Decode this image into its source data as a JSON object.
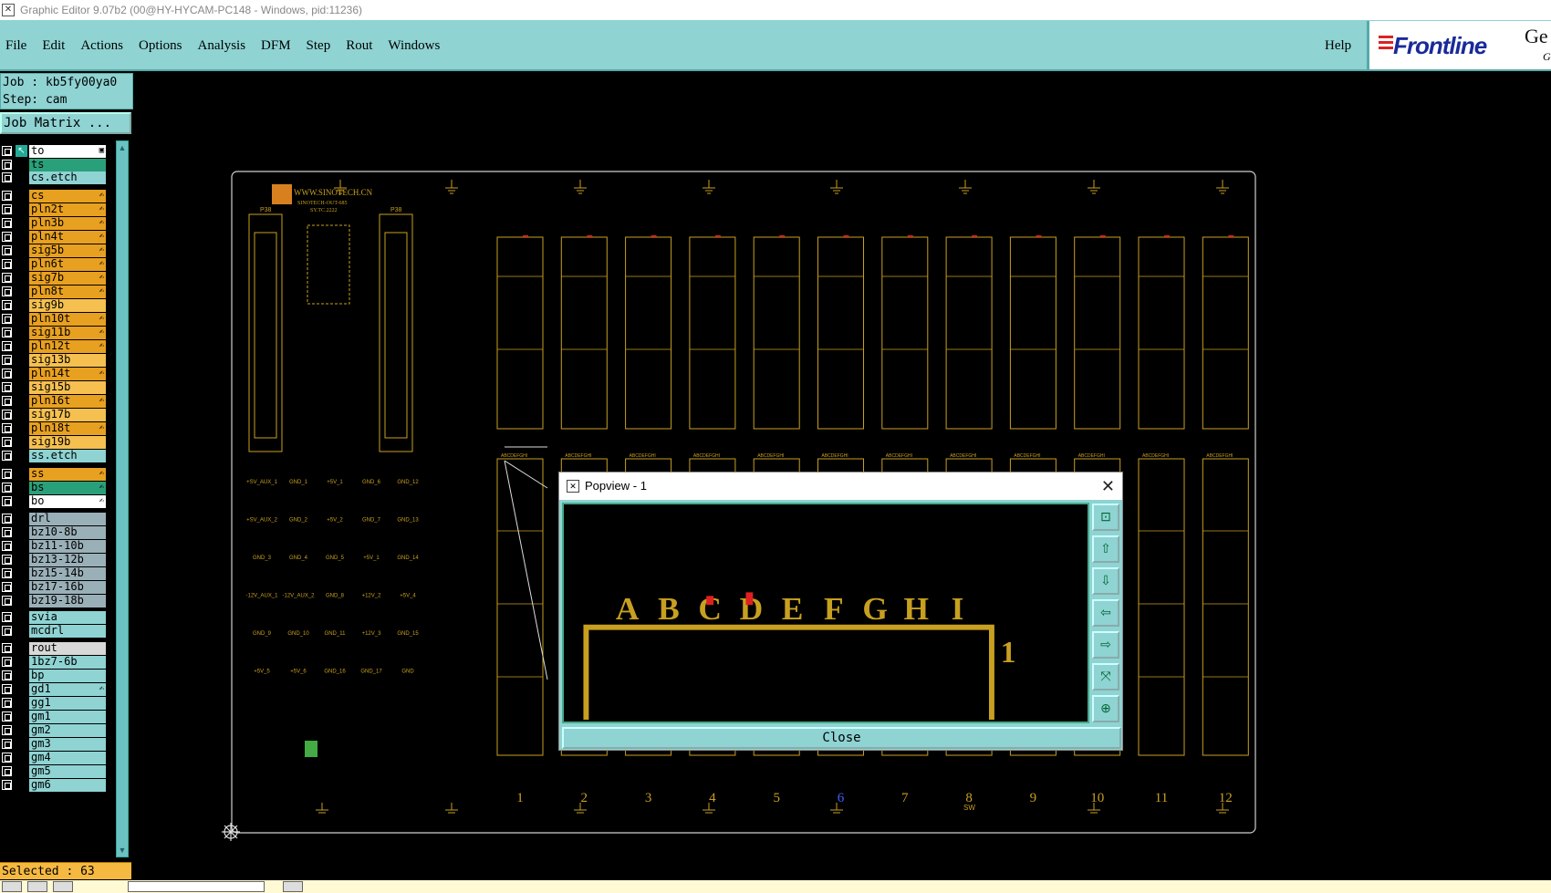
{
  "window": {
    "title": "Graphic Editor 9.07b2 (00@HY-HYCAM-PC148 - Windows, pid:11236)"
  },
  "menu": {
    "items": [
      "File",
      "Edit",
      "Actions",
      "Options",
      "Analysis",
      "DFM",
      "Step",
      "Rout",
      "Windows"
    ],
    "help": "Help"
  },
  "brand": {
    "name": "Frontline",
    "suffix": "Ge",
    "sub": "G"
  },
  "job": {
    "job_line": "Job : kb5fy00ya0",
    "step_line": "Step: cam",
    "matrix_button": "Job Matrix ..."
  },
  "layers": [
    {
      "name": "to",
      "color": "#ffffff",
      "mark": "▣",
      "active": true
    },
    {
      "name": "ts",
      "color": "#2aa07a",
      "mark": ""
    },
    {
      "name": "cs.etch",
      "color": "#8fd3d3",
      "mark": ""
    },
    {
      "name": "cs",
      "color": "#e8a020",
      "mark": "✍"
    },
    {
      "name": "pln2t",
      "color": "#e8a020",
      "mark": "✍"
    },
    {
      "name": "pln3b",
      "color": "#e8a020",
      "mark": "✍"
    },
    {
      "name": "pln4t",
      "color": "#e8a020",
      "mark": "✍"
    },
    {
      "name": "sig5b",
      "color": "#e8a020",
      "mark": "✍"
    },
    {
      "name": "pln6t",
      "color": "#e8a020",
      "mark": "✍"
    },
    {
      "name": "sig7b",
      "color": "#e8a020",
      "mark": "✍"
    },
    {
      "name": "pln8t",
      "color": "#e8a020",
      "mark": "✍"
    },
    {
      "name": "sig9b",
      "color": "#f5c050",
      "mark": ""
    },
    {
      "name": "pln10t",
      "color": "#e8a020",
      "mark": "✍"
    },
    {
      "name": "sig11b",
      "color": "#e8a020",
      "mark": "✍"
    },
    {
      "name": "pln12t",
      "color": "#e8a020",
      "mark": "✍"
    },
    {
      "name": "sig13b",
      "color": "#f5c050",
      "mark": ""
    },
    {
      "name": "pln14t",
      "color": "#e8a020",
      "mark": "✍"
    },
    {
      "name": "sig15b",
      "color": "#f5c050",
      "mark": ""
    },
    {
      "name": "pln16t",
      "color": "#e8a020",
      "mark": "✍"
    },
    {
      "name": "sig17b",
      "color": "#f5c050",
      "mark": ""
    },
    {
      "name": "pln18t",
      "color": "#e8a020",
      "mark": "✍"
    },
    {
      "name": "sig19b",
      "color": "#f5c050",
      "mark": ""
    },
    {
      "name": "ss.etch",
      "color": "#8fd3d3",
      "mark": ""
    },
    {
      "name": "ss",
      "color": "#e8a020",
      "mark": "✍"
    },
    {
      "name": "bs",
      "color": "#2aa07a",
      "mark": "✍"
    },
    {
      "name": "bo",
      "color": "#ffffff",
      "mark": "✍"
    },
    {
      "name": "drl",
      "color": "#9ab0b8",
      "mark": ""
    },
    {
      "name": "bz10-8b",
      "color": "#9ab0b8",
      "mark": ""
    },
    {
      "name": "bz11-10b",
      "color": "#9ab0b8",
      "mark": ""
    },
    {
      "name": "bz13-12b",
      "color": "#9ab0b8",
      "mark": ""
    },
    {
      "name": "bz15-14b",
      "color": "#9ab0b8",
      "mark": ""
    },
    {
      "name": "bz17-16b",
      "color": "#9ab0b8",
      "mark": ""
    },
    {
      "name": "bz19-18b",
      "color": "#9ab0b8",
      "mark": ""
    },
    {
      "name": "svia",
      "color": "#8fd3d3",
      "mark": ""
    },
    {
      "name": "mcdrl",
      "color": "#8fd3d3",
      "mark": ""
    },
    {
      "name": "rout",
      "color": "#d8d8d8",
      "mark": ""
    },
    {
      "name": "1bz7-6b",
      "color": "#8fd3d3",
      "mark": ""
    },
    {
      "name": "bp",
      "color": "#8fd3d3",
      "mark": ""
    },
    {
      "name": "gd1",
      "color": "#8fd3d3",
      "mark": "✍"
    },
    {
      "name": "gg1",
      "color": "#8fd3d3",
      "mark": ""
    },
    {
      "name": "gm1",
      "color": "#8fd3d3",
      "mark": ""
    },
    {
      "name": "gm2",
      "color": "#8fd3d3",
      "mark": ""
    },
    {
      "name": "gm3",
      "color": "#8fd3d3",
      "mark": ""
    },
    {
      "name": "gm4",
      "color": "#8fd3d3",
      "mark": ""
    },
    {
      "name": "gm5",
      "color": "#8fd3d3",
      "mark": ""
    },
    {
      "name": "gm6",
      "color": "#8fd3d3",
      "mark": ""
    }
  ],
  "status": {
    "selected": "Selected : 63"
  },
  "board": {
    "header_text": "WWW.SINOTECH.CN",
    "header_sub": "SINOTECH-OUT-685",
    "header_sub2": "SY.TC.2222",
    "connector_labels": [
      "P38",
      "P38"
    ],
    "column_numbers": [
      "1",
      "2",
      "3",
      "4",
      "5",
      "6",
      "7",
      "8",
      "9",
      "10",
      "11",
      "12"
    ],
    "row_letters": "ABCDEFGHI",
    "net_labels": [
      [
        "+SV_AUX_1",
        "GND_1",
        "+5V_1",
        "GND_6",
        "GND_12"
      ],
      [
        "+SV_AUX_2",
        "GND_2",
        "+5V_2",
        "GND_7",
        "GND_13"
      ],
      [
        "GND_3",
        "GND_4",
        "GND_5",
        "+5V_1",
        "GND_14"
      ],
      [
        "-12V_AUX_1",
        "-12V_AUX_2",
        "GND_8",
        "+12V_2",
        "+5V_4"
      ],
      [
        "GND_9",
        "GND_10",
        "GND_11",
        "+12V_3",
        "GND_15"
      ],
      [
        "+5V_5",
        "+5V_6",
        "GND_16",
        "GND_17",
        "GND"
      ]
    ],
    "sw_label": "SW",
    "accent_color": "#c8a020"
  },
  "popview": {
    "title": "Popview - 1",
    "letters": [
      "A",
      "B",
      "C",
      "D",
      "E",
      "F",
      "G",
      "H",
      "I"
    ],
    "column_label": "1",
    "close_label": "Close",
    "tools": [
      "zoom-box-icon",
      "zoom-up-icon",
      "zoom-down-icon",
      "pan-left-icon",
      "pan-right-icon",
      "fit-icon",
      "center-icon"
    ]
  }
}
